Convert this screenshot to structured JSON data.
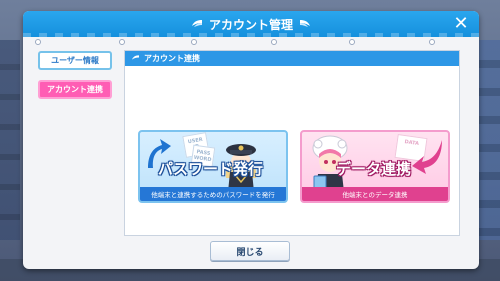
{
  "dialog": {
    "title": "アカウント管理",
    "close_symbol": "✕"
  },
  "sidebar": {
    "items": [
      {
        "label": "ユーザー情報",
        "active": false
      },
      {
        "label": "アカウント連携",
        "active": true
      }
    ]
  },
  "panel": {
    "header": "アカウント連携"
  },
  "cards": [
    {
      "title": "パスワード発行",
      "subtitle": "他端末と連携するためのパスワードを発行",
      "paper_top": "USER ID",
      "paper_bottom": "PASS WORD"
    },
    {
      "title": "データ連携",
      "subtitle": "他端末とのデータ連携",
      "paper_top": "DATA"
    }
  ],
  "footer": {
    "close_label": "閉じる"
  },
  "colors": {
    "header_blue": "#1d9be6",
    "active_pink": "#ff5db4",
    "card_blue": "#2577d6",
    "card_pink": "#e0418f"
  }
}
